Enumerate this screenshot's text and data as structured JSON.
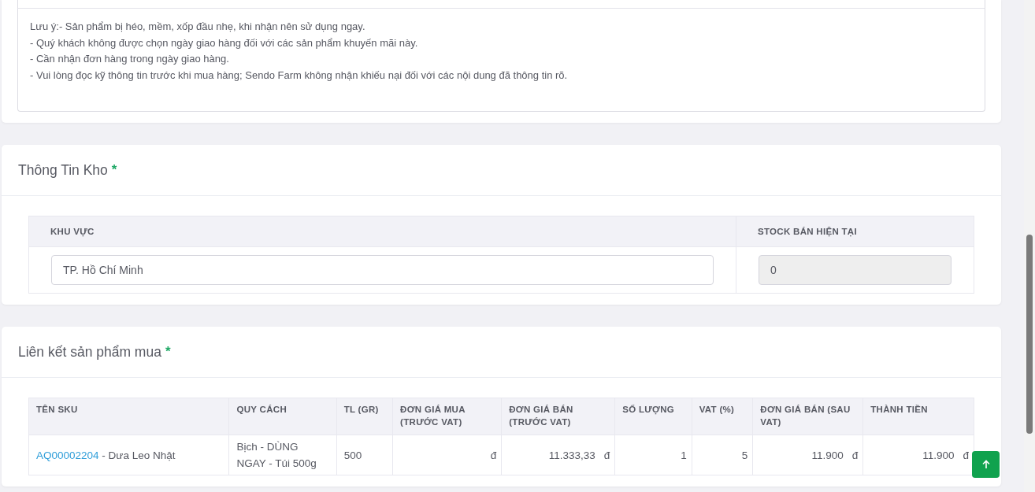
{
  "note": {
    "lines": [
      "Lưu ý:- Sản phẩm bị héo, mềm, xốp đầu nhẹ, khi nhận nên sử dụng ngay.",
      "- Quý khách không được chọn ngày giao hàng đối với các sản phẩm khuyến mãi này.",
      "- Cần nhận đơn hàng trong ngày giao hàng.",
      "- Vui lòng đọc kỹ thông tin trước khi mua hàng; Sendo Farm không nhận khiếu nại đối với các nội dung đã thông tin rõ."
    ]
  },
  "warehouse": {
    "title": "Thông Tin Kho",
    "required_mark": "*",
    "columns": [
      "KHU VỰC",
      "STOCK BÁN HIỆN TẠI"
    ],
    "region": {
      "value": "TP. Hồ Chí Minh"
    },
    "stock": {
      "value": "0",
      "disabled": true
    }
  },
  "linked_products": {
    "title": "Liên kết sản phẩm mua",
    "required_mark": "*",
    "columns": [
      "TÊN SKU",
      "QUY CÁCH",
      "TL (GR)",
      "ĐƠN GIÁ MUA (TRƯỚC VAT)",
      "ĐƠN GIÁ BÁN (TRƯỚC VAT)",
      "SỐ LƯỢNG",
      "VAT (%)",
      "ĐƠN GIÁ BÁN (SAU VAT)",
      "THÀNH TIỀN"
    ],
    "rows": [
      {
        "sku_code": "AQ00002204",
        "sku_name": "- Dưa Leo Nhật",
        "spec": "Bịch - DÙNG NGAY - Túi 500g",
        "weight": "500",
        "buy_price": {
          "currency": "đ"
        },
        "sell_price": {
          "value": "11.333,33",
          "currency": "đ"
        },
        "quantity": "1",
        "vat": "5",
        "sell_price_vat": {
          "value": "11.900",
          "currency": "đ"
        },
        "total": {
          "value": "11.900",
          "currency": "đ"
        }
      }
    ]
  }
}
